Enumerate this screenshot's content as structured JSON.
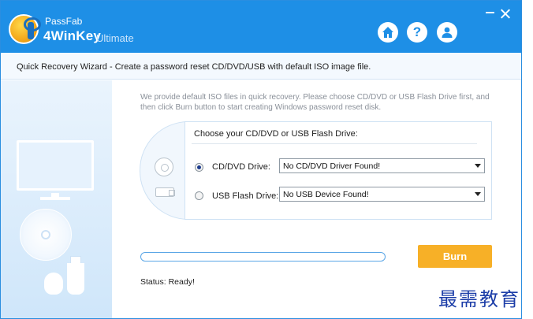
{
  "app": {
    "brand_small": "PassFab",
    "brand_big": "4WinKey",
    "brand_edition": "Ultimate"
  },
  "titlebar": {
    "help_glyph": "?",
    "icons": [
      "home-icon",
      "help-icon",
      "user-icon",
      "minimize-icon",
      "close-icon"
    ]
  },
  "wizard": {
    "title": "Quick Recovery Wizard - Create a password reset CD/DVD/USB with default ISO image file."
  },
  "main": {
    "intro": "We provide default ISO files in quick recovery. Please choose CD/DVD or USB Flash Drive first, and then click Burn button to start creating Windows password reset disk.",
    "selector_title": "Choose your CD/DVD or USB Flash Drive:",
    "options": [
      {
        "label": "CD/DVD Drive:",
        "selected": true,
        "dropdown_value": "No CD/DVD Driver Found!"
      },
      {
        "label": "USB Flash Drive:",
        "selected": false,
        "dropdown_value": "No USB Device Found!"
      }
    ],
    "progress": 0,
    "burn_label": "Burn",
    "status": "Status: Ready!"
  },
  "watermark": "最需教育",
  "colors": {
    "titlebar": "#1e8fe6",
    "accent_button": "#f7b027",
    "progress_border": "#5aa6e6"
  }
}
